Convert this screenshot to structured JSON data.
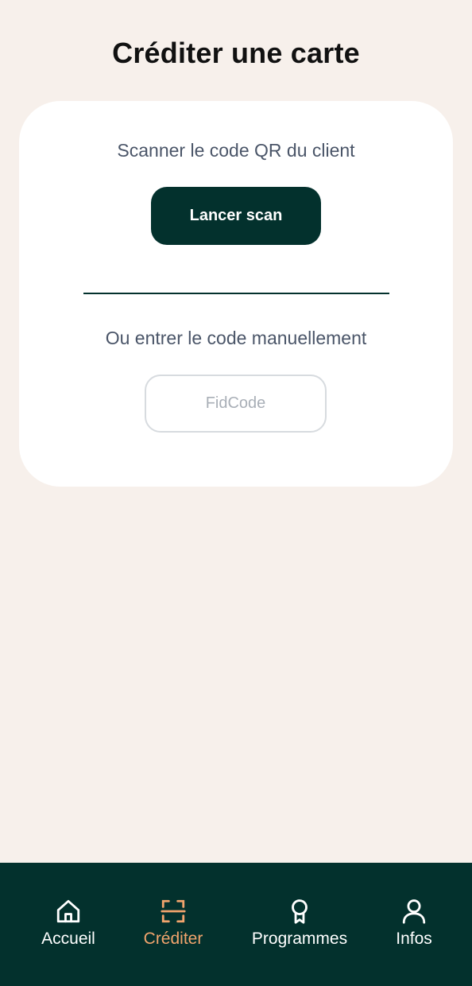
{
  "header": {
    "title": "Créditer une carte"
  },
  "card": {
    "scan_label": "Scanner le code QR du client",
    "scan_button_label": "Lancer scan",
    "manual_label": "Ou entrer le code manuellement",
    "code_input": {
      "value": "",
      "placeholder": "FidCode"
    }
  },
  "nav": {
    "items": [
      {
        "label": "Accueil",
        "icon": "home-icon",
        "active": false
      },
      {
        "label": "Créditer",
        "icon": "scan-icon",
        "active": true
      },
      {
        "label": "Programmes",
        "icon": "award-icon",
        "active": false
      },
      {
        "label": "Infos",
        "icon": "user-icon",
        "active": false
      }
    ]
  },
  "colors": {
    "background": "#F7F0EB",
    "primary": "#03312D",
    "accent": "#F1A46D",
    "card": "#FFFFFF"
  }
}
